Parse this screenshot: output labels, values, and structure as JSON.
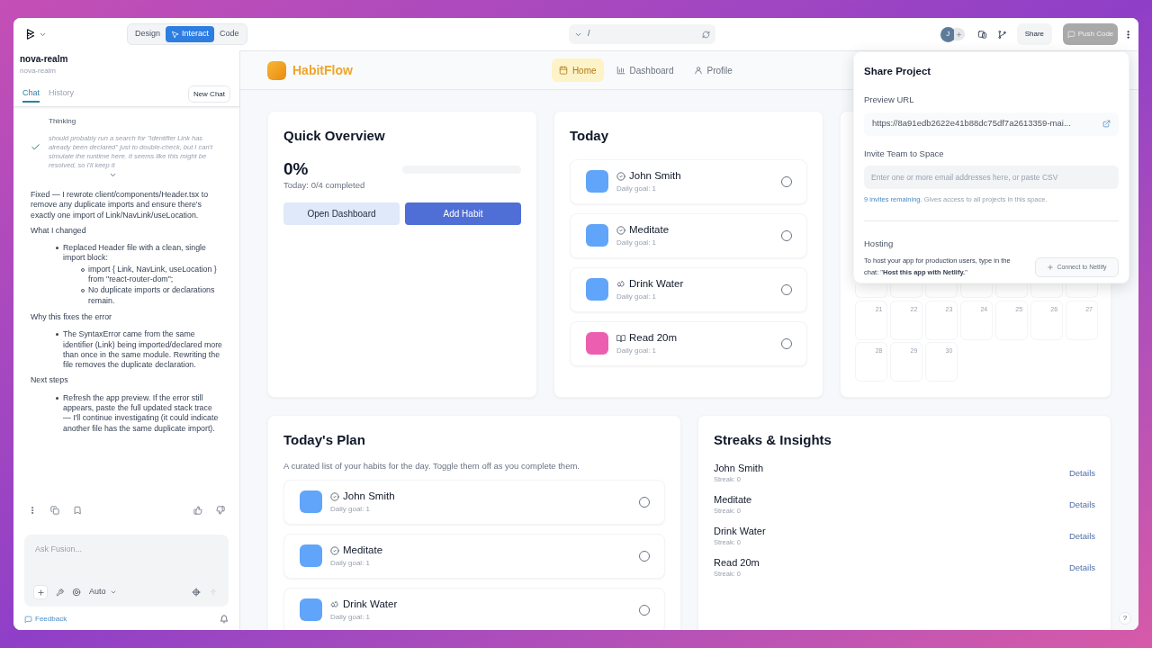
{
  "topbar": {
    "modes": [
      {
        "label": "Design",
        "selected": false
      },
      {
        "label": "Interact",
        "selected": true
      },
      {
        "label": "Code",
        "selected": false
      }
    ],
    "url_path": "/",
    "avatar": "J",
    "share": "Share",
    "push_code": {
      "label": "Push Code",
      "disabled": true
    }
  },
  "chat": {
    "project_title": "nova-realm",
    "project_subtitle": "nova-realm",
    "tabs": [
      {
        "label": "Chat",
        "selected": true
      },
      {
        "label": "History",
        "selected": false
      }
    ],
    "new_chat": "New Chat",
    "thinking": {
      "label": "Thinking",
      "text": "should probably run a search for \"Identifier Link has already been declared\" just to double-check, but I can't simulate the runtime here. It seems like this might be resolved, so I'll keep it"
    },
    "message": [
      {
        "kind": "paragraph",
        "text": "Fixed — I rewrote client/components/Header.tsx to remove any duplicate imports and ensure there's exactly one import of Link/NavLink/useLocation."
      },
      {
        "kind": "heading",
        "text": "What I changed"
      },
      {
        "kind": "list",
        "items": [
          {
            "text": "Replaced Header file with a clean, single import block:",
            "children": [
              {
                "text": "import { Link, NavLink, useLocation } from \"react-router-dom\";"
              },
              {
                "text": "No duplicate imports or declarations remain."
              }
            ]
          }
        ]
      },
      {
        "kind": "heading",
        "text": "Why this fixes the error"
      },
      {
        "kind": "list",
        "items": [
          {
            "text": "The SyntaxError came from the same identifier (Link) being imported/declared more than once in the same module. Rewriting the file removes the duplicate declaration."
          }
        ]
      },
      {
        "kind": "heading",
        "text": "Next steps"
      },
      {
        "kind": "list",
        "items": [
          {
            "text": "Refresh the app preview. If the error still appears, paste the full updated stack trace — I'll continue investigating (it could indicate another file has the same duplicate import)."
          }
        ]
      }
    ],
    "input_placeholder": "Ask Fusion...",
    "model": "Auto",
    "feedback": "Feedback"
  },
  "app": {
    "brand": "HabitFlow",
    "nav": [
      {
        "label": "Home",
        "kind": "calendar",
        "selected": true
      },
      {
        "label": "Dashboard",
        "kind": "chart",
        "selected": false
      },
      {
        "label": "Profile",
        "kind": "user",
        "selected": false
      }
    ],
    "overview": {
      "title": "Quick Overview",
      "percent": "0%",
      "summary": "Today: 0/4 completed",
      "level": 0,
      "buttons": [
        "Open Dashboard",
        "Add Habit"
      ]
    },
    "today": {
      "title": "Today",
      "habits": [
        {
          "name": "John Smith",
          "goal": "Daily goal: 1",
          "color": "#60a5fa",
          "kind": "check",
          "checked": false
        },
        {
          "name": "Meditate",
          "goal": "Daily goal: 1",
          "color": "#60a5fa",
          "kind": "check",
          "checked": false
        },
        {
          "name": "Drink Water",
          "goal": "Daily goal: 1",
          "color": "#60a5fa",
          "kind": "drops",
          "checked": false
        },
        {
          "name": "Read 20m",
          "goal": "Daily goal: 1",
          "color": "#ec5fb0",
          "kind": "book",
          "checked": false
        }
      ]
    },
    "calendar": {
      "weeks": [
        [
          "21",
          "22",
          "23",
          "24",
          "25",
          "26",
          "27"
        ],
        [
          "28",
          "29",
          "30"
        ]
      ]
    },
    "plan": {
      "title": "Today's Plan",
      "subtitle": "A curated list of your habits for the day. Toggle them off as you complete them.",
      "habits": [
        {
          "name": "John Smith",
          "goal": "Daily goal: 1",
          "color": "#60a5fa",
          "kind": "check",
          "checked": false
        },
        {
          "name": "Meditate",
          "goal": "Daily goal: 1",
          "color": "#60a5fa",
          "kind": "check",
          "checked": false
        },
        {
          "name": "Drink Water",
          "goal": "Daily goal: 1",
          "color": "#60a5fa",
          "kind": "drops",
          "checked": false
        }
      ]
    },
    "streaks": {
      "title": "Streaks & Insights",
      "items": [
        {
          "name": "John Smith",
          "streak": "Streak: 0",
          "action": "Details"
        },
        {
          "name": "Meditate",
          "streak": "Streak: 0",
          "action": "Details"
        },
        {
          "name": "Drink Water",
          "streak": "Streak: 0",
          "action": "Details"
        },
        {
          "name": "Read 20m",
          "streak": "Streak: 0",
          "action": "Details"
        }
      ]
    },
    "help": "?"
  },
  "share_popup": {
    "title": "Share Project",
    "preview_label": "Preview URL",
    "preview_url": "https://8a91edb2622e41b88dc75df7a2613359-mai...",
    "invite_label": "Invite Team to Space",
    "invite_placeholder": "Enter one or more email addresses here, or paste CSV",
    "invites_link": "9 invites remaining.",
    "invites_note": "Gives access to all projects in this space.",
    "hosting_label": "Hosting",
    "hosting_text": "To host your app for production users, type in the chat: \"**Host this app with Netlify.**\"",
    "connect": {
      "label": "Connect to Netlify",
      "disabled": true
    }
  }
}
